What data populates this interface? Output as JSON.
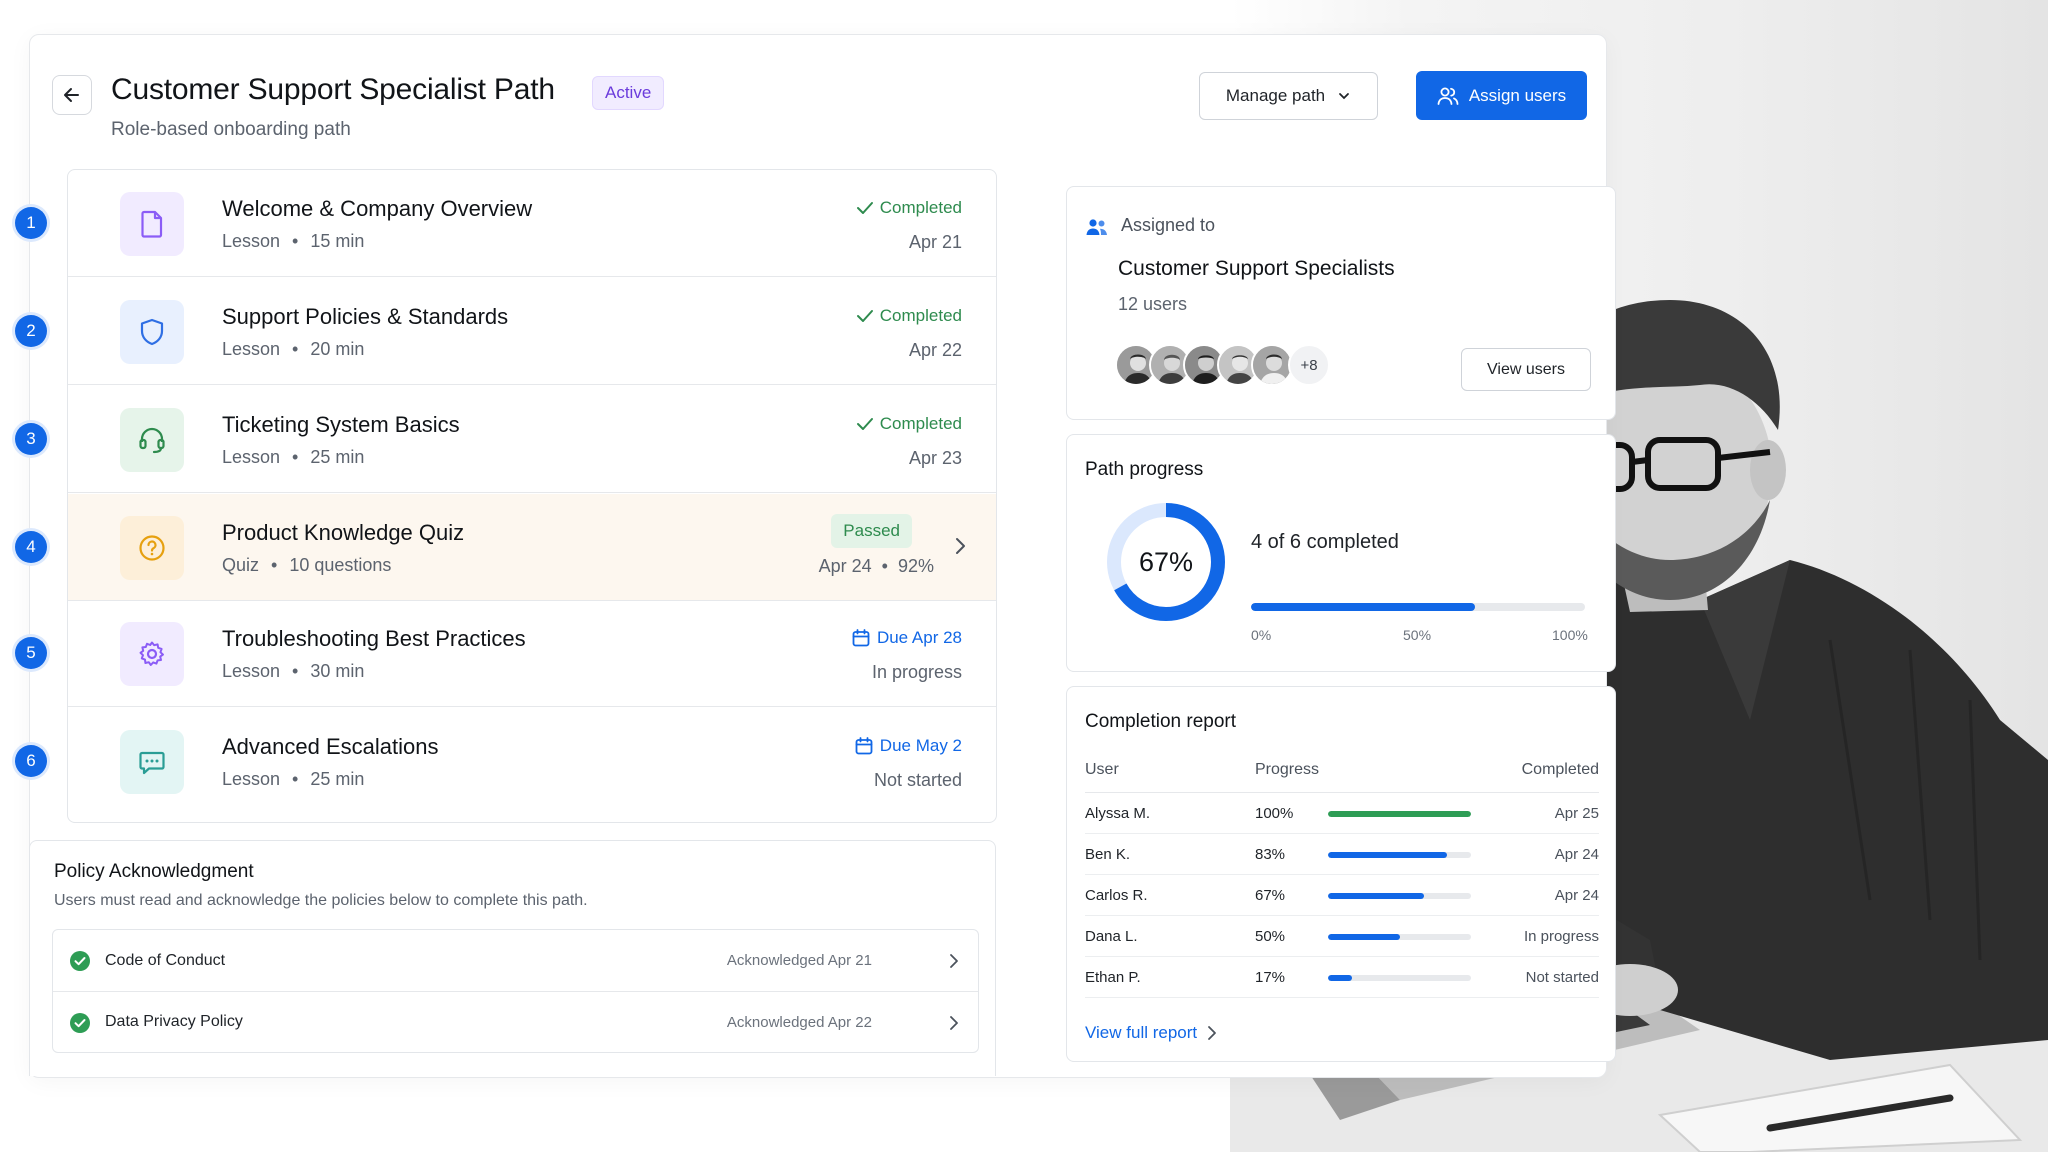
{
  "header": {
    "title": "Customer Support Specialist Path",
    "status_badge": "Active",
    "subtitle": "Role-based onboarding path",
    "manage_label": "Manage path",
    "assign_label": "Assign users"
  },
  "steps": [
    {
      "number": "1",
      "title": "Welcome & Company Overview",
      "type": "Lesson",
      "detail": "15 min",
      "status": "Completed",
      "sub": "Apr 21",
      "icon": "document-icon"
    },
    {
      "number": "2",
      "title": "Support Policies & Standards",
      "type": "Lesson",
      "detail": "20 min",
      "status": "Completed",
      "sub": "Apr 22",
      "icon": "shield-icon"
    },
    {
      "number": "3",
      "title": "Ticketing System Basics",
      "type": "Lesson",
      "detail": "25 min",
      "status": "Completed",
      "sub": "Apr 23",
      "icon": "headset-icon"
    },
    {
      "number": "4",
      "title": "Product Knowledge Quiz",
      "type": "Quiz",
      "detail": "10 questions",
      "status": "Passed",
      "sub": "Apr 24",
      "score": "92%",
      "icon": "question-icon"
    },
    {
      "number": "5",
      "title": "Troubleshooting Best Practices",
      "type": "Lesson",
      "detail": "30 min",
      "status": "Due Apr 28",
      "sub": "In progress",
      "icon": "gear-icon"
    },
    {
      "number": "6",
      "title": "Advanced Escalations",
      "type": "Lesson",
      "detail": "25 min",
      "status": "Due May 2",
      "sub": "Not started",
      "icon": "chat-icon"
    }
  ],
  "policy": {
    "title": "Policy Acknowledgment",
    "description": "Users must read and acknowledge the policies below to complete this path.",
    "items": [
      {
        "name": "Code of Conduct",
        "ack": "Acknowledged Apr 21"
      },
      {
        "name": "Data Privacy Policy",
        "ack": "Acknowledged Apr 22"
      }
    ]
  },
  "assigned": {
    "label": "Assigned to",
    "group": "Customer Support Specialists",
    "count": "12 users",
    "more": "+8",
    "view_users_label": "View users"
  },
  "progress": {
    "title": "Path progress",
    "percent_label": "67%",
    "percent": 0.67,
    "summary": "4 of 6 completed",
    "ticks": [
      "0%",
      "50%",
      "100%"
    ]
  },
  "report": {
    "title": "Completion report",
    "columns": [
      "User",
      "Progress",
      "Completed"
    ],
    "rows": [
      {
        "user": "Alyssa M.",
        "pct": "100%",
        "value": 1.0,
        "date": "Apr 25",
        "color": "#2e9d55"
      },
      {
        "user": "Ben K.",
        "pct": "83%",
        "value": 0.83,
        "date": "Apr 24",
        "color": "#1167e6"
      },
      {
        "user": "Carlos R.",
        "pct": "67%",
        "value": 0.67,
        "date": "Apr 24",
        "color": "#1167e6"
      },
      {
        "user": "Dana L.",
        "pct": "50%",
        "value": 0.5,
        "date": "In progress",
        "color": "#1167e6"
      },
      {
        "user": "Ethan P.",
        "pct": "17%",
        "value": 0.17,
        "date": "Not started",
        "color": "#1167e6"
      }
    ],
    "link_label": "View full report"
  },
  "colors": {
    "accent": "#1167e6",
    "success": "#2e8b4e",
    "badge_purple": "#6b3bdc"
  }
}
